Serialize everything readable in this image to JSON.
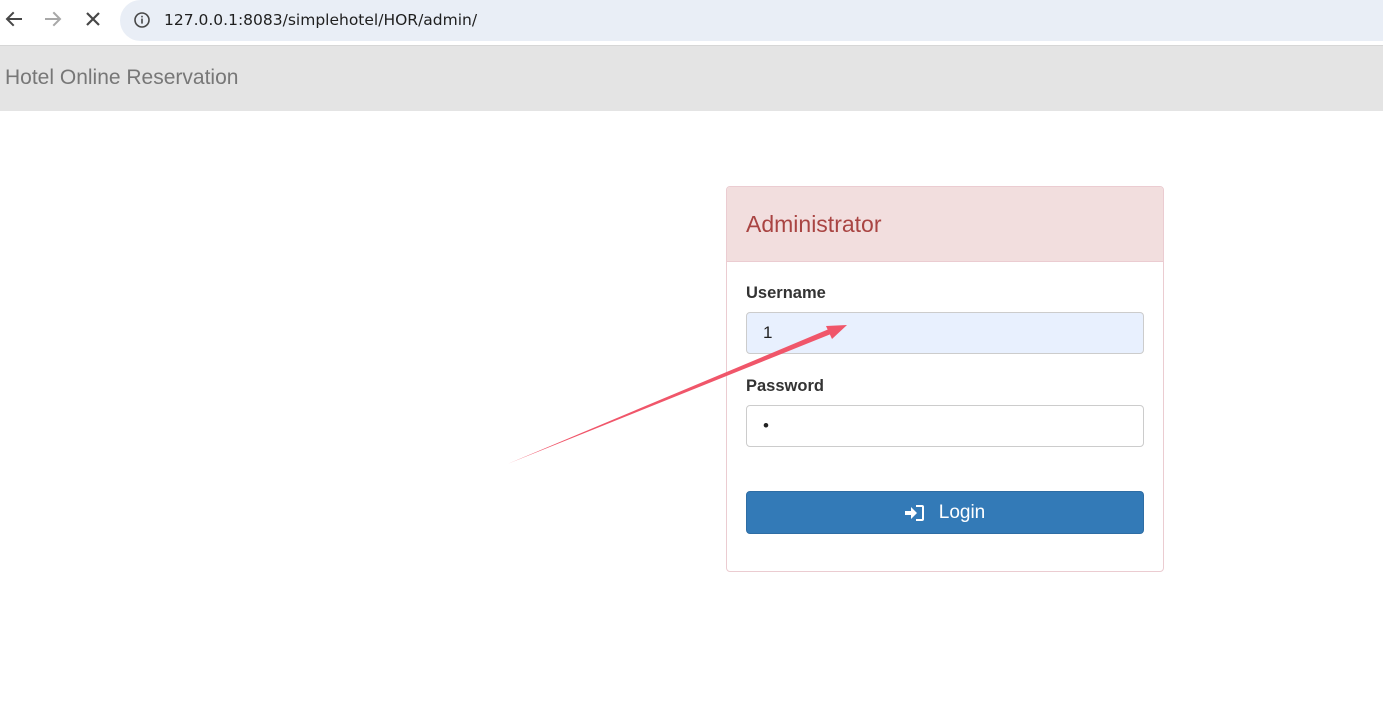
{
  "browser": {
    "url": "127.0.0.1:8083/simplehotel/HOR/admin/",
    "icons": [
      "back-arrow-icon",
      "forward-arrow-icon",
      "stop-loading-icon",
      "site-info-icon"
    ]
  },
  "navbar": {
    "brand": "Hotel Online Reservation"
  },
  "login_panel": {
    "title": "Administrator",
    "username_label": "Username",
    "username_value": "1",
    "password_label": "Password",
    "password_value": "•",
    "login_button_label": "Login",
    "login_icon": "sign-in-icon"
  },
  "colors": {
    "navbar_bg": "#e4e4e4",
    "panel_heading_bg": "#f2dede",
    "panel_title": "#a94442",
    "autofill_bg": "#e8f0fe",
    "primary_button": "#337ab7",
    "annotation_arrow": "#f0566a"
  }
}
